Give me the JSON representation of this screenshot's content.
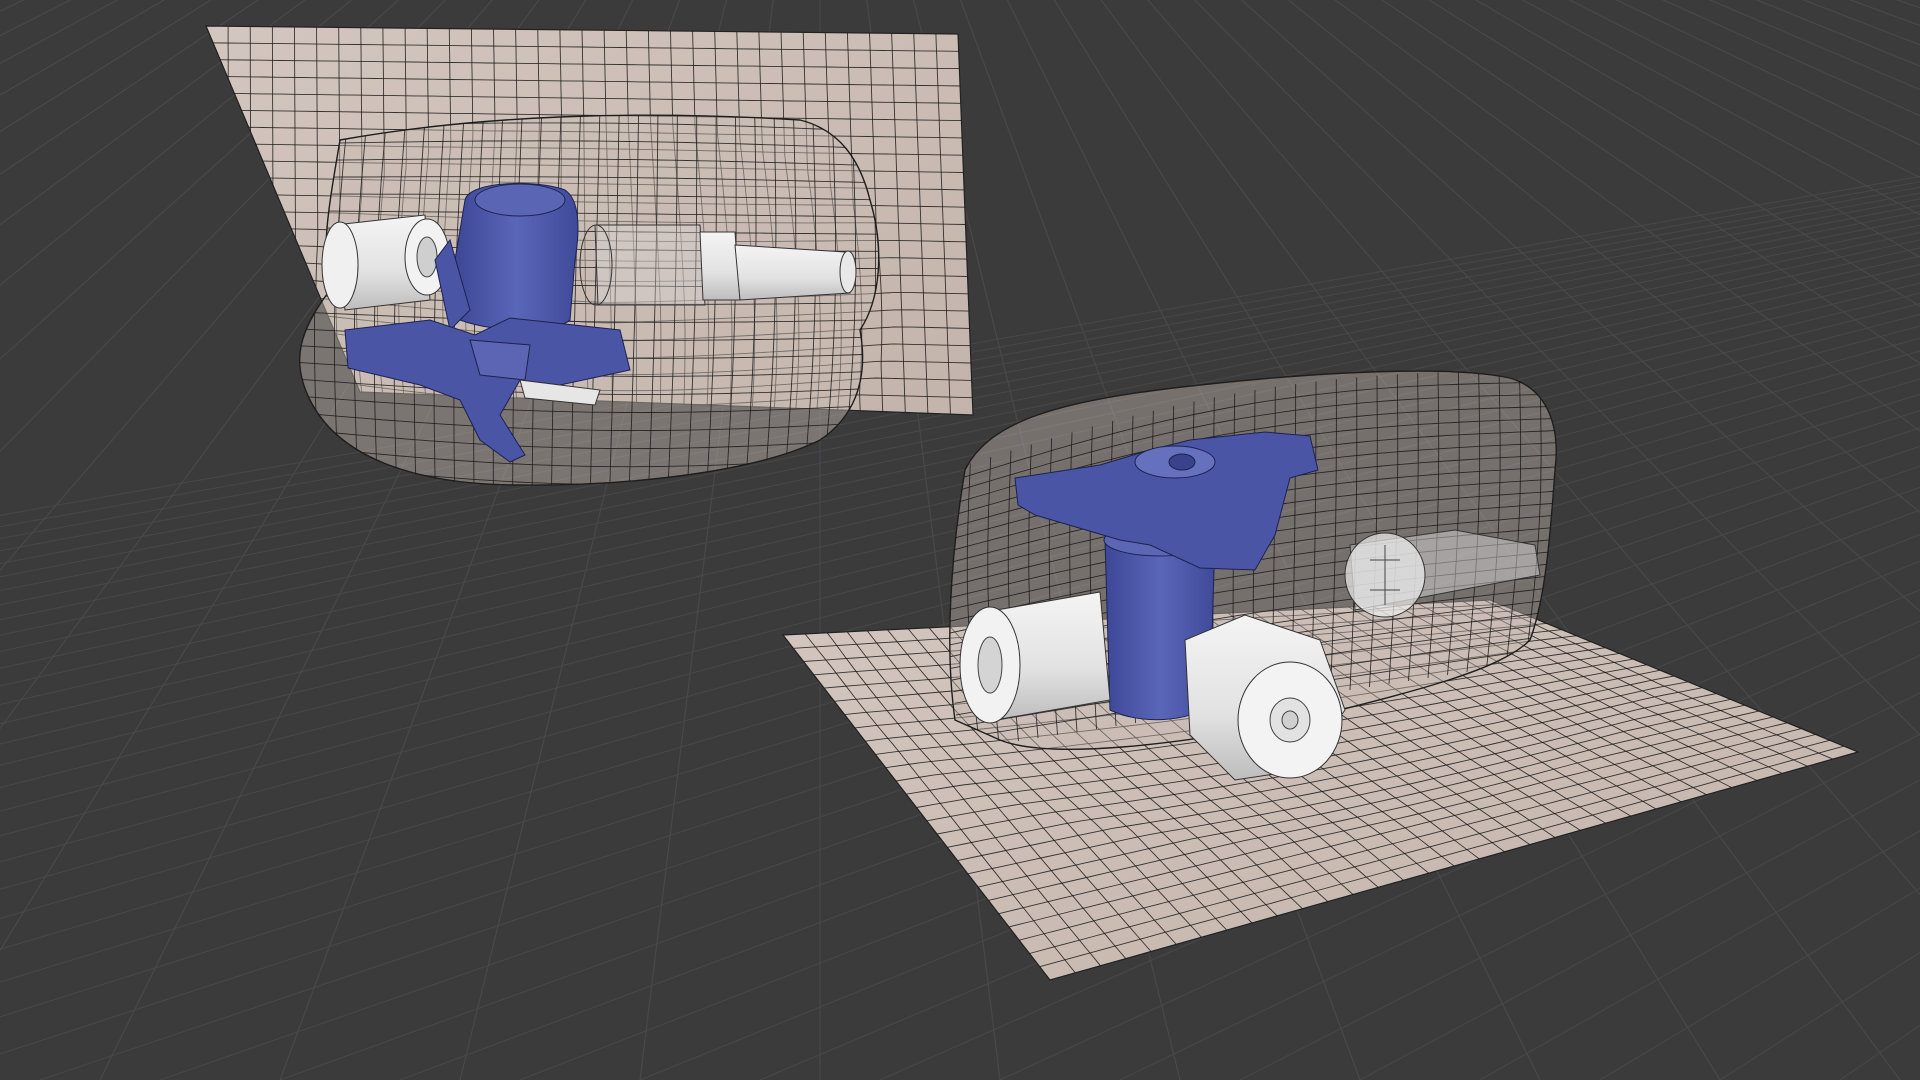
{
  "viewport": {
    "background": "#3b3b3c",
    "grid_color": "#4a4a4c",
    "projection": "perspective",
    "floor_grid": true
  },
  "colors": {
    "surface_fill": "#cdbfb7",
    "mesh_wire": "#1a1a1a",
    "valve_body": "#4f5ba8",
    "valve_handle": "#4a55a6",
    "fitting": "#e9e9e9",
    "fitting_shadow": "#b9b9b9"
  },
  "objects": [
    {
      "label": "mold-surface-tilted",
      "kind": "wireframe-surface"
    },
    {
      "label": "valve-assembly-tilted",
      "kind": "solid-wireframe"
    },
    {
      "label": "mold-surface-flat",
      "kind": "wireframe-surface"
    },
    {
      "label": "valve-assembly-flat",
      "kind": "solid-wireframe"
    }
  ]
}
